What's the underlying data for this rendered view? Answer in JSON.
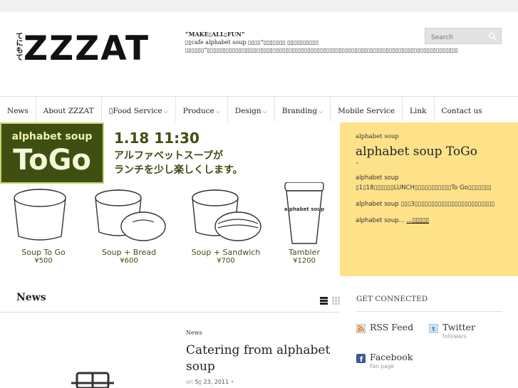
{
  "colors": {
    "accent_yellow": "#fde28a",
    "banner_green": "#3f4f12",
    "topbar": "#f0f0f0"
  },
  "logo": {
    "kanji": "てにもて",
    "text": "ZZZAT"
  },
  "tagline": {
    "title": "“MAKE▯ALL▯FUN”",
    "body": "▯▯cafe alphabet soup ▯▯▯▯“▯▯▯▯▯▯▯ ▯▯▯▯▯▯▯▯▯▯ ▯▯▯▯▯▯“▯▯▯▯▯▯▯▯▯▯▯▯▯▯▯▯▯▯▯▯▯▯▯▯▯▯▯▯▯▯▯▯▯▯▯▯▯▯▯▯▯▯▯▯▯▯▯▯▯▯▯▯▯▯▯▯▯▯▯▯▯▯▯▯▯▯▯▯▯▯▯▯▯▯▯▯▯▯▯▯"
  },
  "search": {
    "placeholder": "Search",
    "icon": "search-icon"
  },
  "nav": {
    "items": [
      {
        "label": "News",
        "dropdown": false
      },
      {
        "label": "About ZZZAT",
        "dropdown": false
      },
      {
        "label": "▯Food Service",
        "dropdown": true
      },
      {
        "label": "Produce",
        "dropdown": true
      },
      {
        "label": "Design",
        "dropdown": true
      },
      {
        "label": "Branding",
        "dropdown": true
      },
      {
        "label": "Mobile Service",
        "dropdown": false
      },
      {
        "label": "Link",
        "dropdown": false
      },
      {
        "label": "Contact us",
        "dropdown": false
      }
    ]
  },
  "banner": {
    "logo_small": "alphabet soup",
    "logo_big": "ToGo",
    "time": "1.18 11:30",
    "line1": "アルファベットスープが",
    "line2": "ランチを少し楽しくします。",
    "products": [
      {
        "name": "Soup To Go",
        "price": "¥500"
      },
      {
        "name": "Soup + Bread",
        "price": "¥600"
      },
      {
        "name": "Soup + Sandwich",
        "price": "¥700"
      },
      {
        "name": "Tambler",
        "price": "¥1200"
      }
    ]
  },
  "feature": {
    "category": "alphabet soup",
    "title": "alphabet soup ToGo",
    "meta": "•",
    "p1": "alphabet soup ▯1▯18▯▯▯▯▯▯LUNCH▯▯▯▯▯▯▯▯▯▯▯To Go▯▯▯▯▯▯▯",
    "p2": "alphabet soup ▯▯▯3▯▯▯▯▯▯▯▯▯▯▯▯▯▯▯▯▯▯▯▯▯▯▯▯",
    "p3": "alphabet soup...",
    "more": "...▯▯▯▯▯"
  },
  "news": {
    "heading": "News",
    "post": {
      "category": "News",
      "title": "Catering from alphabet soup",
      "meta_prefix": "on",
      "date": "5▯ 23, 2011",
      "meta_suffix": "•"
    }
  },
  "connect": {
    "heading": "GET CONNECTED",
    "items": [
      {
        "name": "RSS Feed",
        "sub": "",
        "icon": "rss-icon"
      },
      {
        "name": "Twitter",
        "sub": "followers",
        "icon": "twitter-icon"
      },
      {
        "name": "Facebook",
        "sub": "Fan page",
        "icon": "facebook-icon"
      }
    ]
  }
}
